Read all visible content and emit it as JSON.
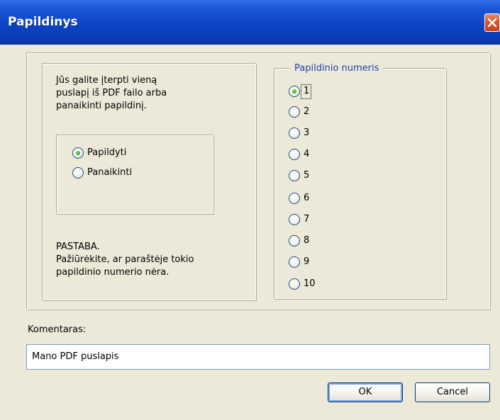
{
  "window": {
    "title": "Papildinys"
  },
  "intro_lines": [
    "Jūs galite įterpti vieną",
    "puslapį iš PDF failo arba",
    "panaikinti papildinį."
  ],
  "action": {
    "selected": "Papildyti",
    "options": [
      "Papildyti",
      "Panaikinti"
    ]
  },
  "note_lines": [
    "PASTABA.",
    "Pažiūrėkite, ar paraštėje tokio",
    "papildinio numerio nėra."
  ],
  "numbers_group": {
    "legend": "Papildinio numeris",
    "selected": "1",
    "options": [
      "1",
      "2",
      "3",
      "4",
      "5",
      "6",
      "7",
      "8",
      "9",
      "10"
    ]
  },
  "comment": {
    "label": "Komentaras:",
    "value": "Mano PDF puslapis"
  },
  "buttons": {
    "ok": "OK",
    "cancel": "Cancel"
  },
  "icons": {
    "close": "close-icon"
  },
  "colors": {
    "titlebar": "#0a43c6",
    "close_button": "#d9542c",
    "dialog_background": "#ece9d8",
    "legend_text": "#1f3fae",
    "radio_dot": "#2fa114"
  }
}
